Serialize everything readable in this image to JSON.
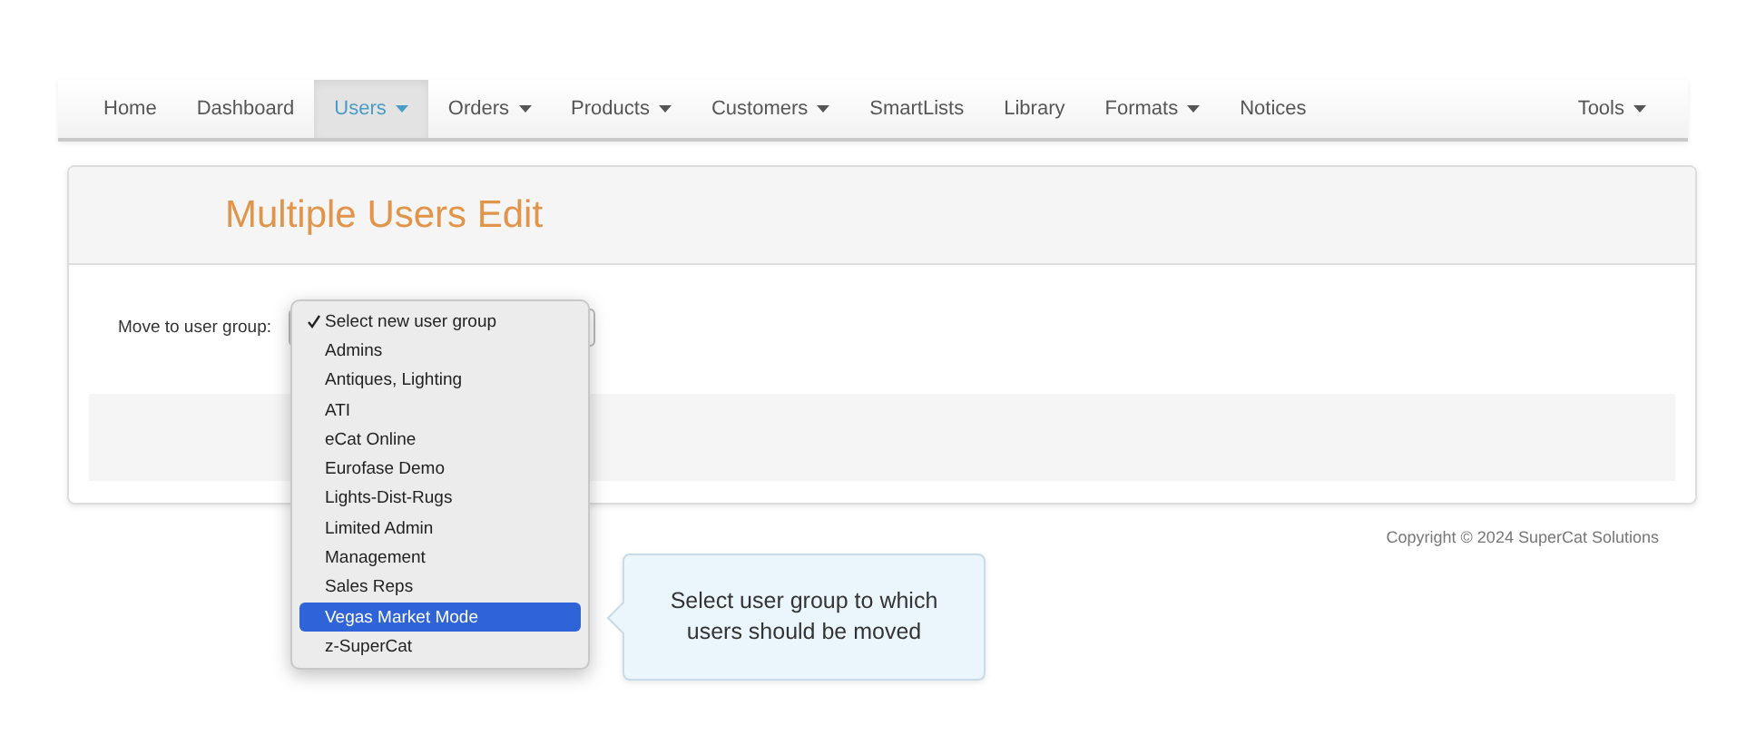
{
  "navbar": {
    "items": [
      {
        "label": "Home",
        "dropdown": false,
        "selected": false
      },
      {
        "label": "Dashboard",
        "dropdown": false,
        "selected": false
      },
      {
        "label": "Users",
        "dropdown": true,
        "selected": true
      },
      {
        "label": "Orders",
        "dropdown": true,
        "selected": false
      },
      {
        "label": "Products",
        "dropdown": true,
        "selected": false
      },
      {
        "label": "Customers",
        "dropdown": true,
        "selected": false
      },
      {
        "label": "SmartLists",
        "dropdown": false,
        "selected": false
      },
      {
        "label": "Library",
        "dropdown": false,
        "selected": false
      },
      {
        "label": "Formats",
        "dropdown": true,
        "selected": false
      },
      {
        "label": "Notices",
        "dropdown": false,
        "selected": false
      }
    ],
    "right_items": [
      {
        "label": "Tools",
        "dropdown": true,
        "selected": false
      }
    ]
  },
  "page_title": "Multiple Users Edit",
  "form": {
    "label": "Move to user group:",
    "select": {
      "options": [
        {
          "label": "Select new user group",
          "checked": true,
          "selected": false
        },
        {
          "label": "Admins",
          "checked": false,
          "selected": false
        },
        {
          "label": "Antiques, Lighting",
          "checked": false,
          "selected": false
        },
        {
          "label": "ATI",
          "checked": false,
          "selected": false
        },
        {
          "label": "eCat Online",
          "checked": false,
          "selected": false
        },
        {
          "label": "Eurofase Demo",
          "checked": false,
          "selected": false
        },
        {
          "label": "Lights-Dist-Rugs",
          "checked": false,
          "selected": false
        },
        {
          "label": "Limited Admin",
          "checked": false,
          "selected": false
        },
        {
          "label": "Management",
          "checked": false,
          "selected": false
        },
        {
          "label": "Sales Reps",
          "checked": false,
          "selected": false
        },
        {
          "label": "Vegas Market Mode",
          "checked": false,
          "selected": true
        },
        {
          "label": "z-SuperCat",
          "checked": false,
          "selected": false
        }
      ]
    }
  },
  "tooltip": "Select user group to which users should be moved",
  "footer": "Copyright © 2024 SuperCat Solutions"
}
